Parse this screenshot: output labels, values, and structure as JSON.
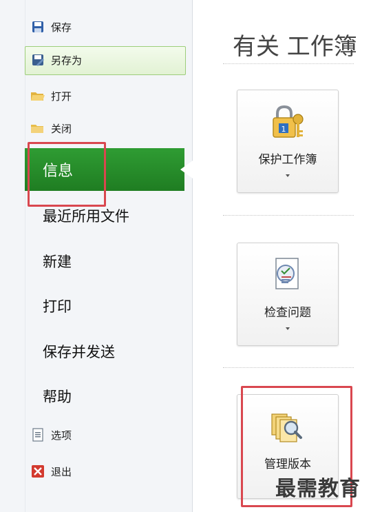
{
  "sidebar": {
    "save": "保存",
    "save_as": "另存为",
    "open": "打开",
    "close": "关闭",
    "info": "信息",
    "recent": "最近所用文件",
    "new": "新建",
    "print": "打印",
    "save_send": "保存并发送",
    "help": "帮助",
    "options": "选项",
    "exit": "退出"
  },
  "main": {
    "title": "有关 工作簿",
    "tiles": [
      {
        "label": "保护工作簿",
        "icon": "lock-key-icon"
      },
      {
        "label": "检查问题",
        "icon": "document-checklist-icon"
      },
      {
        "label": "管理版本",
        "icon": "document-magnifier-icon"
      }
    ]
  },
  "watermark": "最需教育",
  "colors": {
    "selected_green": "#2a8f2d",
    "highlight_red": "#d9474f",
    "save_as_bg": "#e8f5dc"
  }
}
